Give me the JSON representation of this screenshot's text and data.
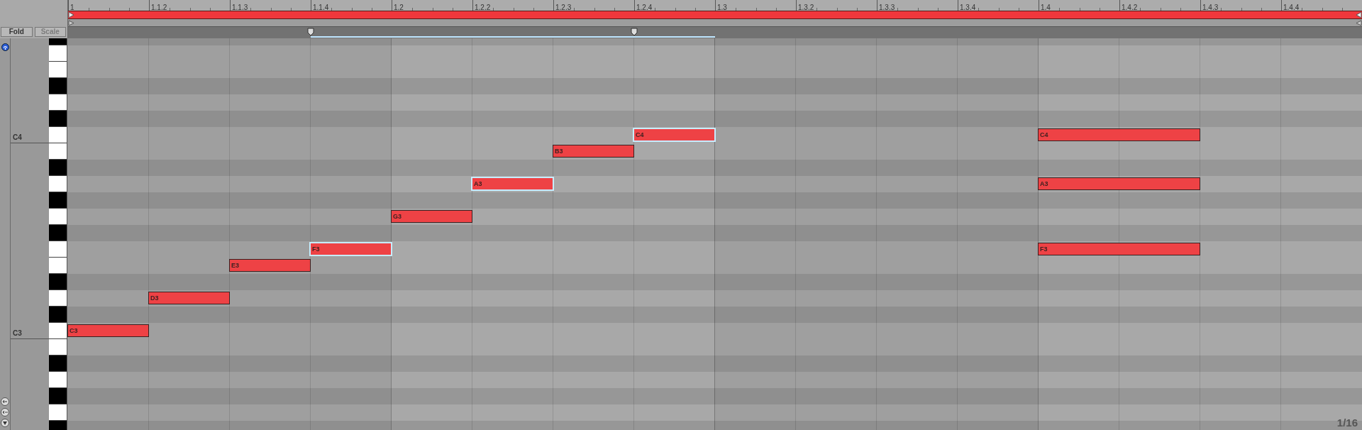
{
  "ruler": {
    "columns": [
      {
        "label": "1",
        "in_region": false,
        "marker": false
      },
      {
        "label": "1.1.2",
        "in_region": false,
        "marker": false
      },
      {
        "label": "1.1.3",
        "in_region": false,
        "marker": false
      },
      {
        "label": "1.1.4",
        "in_region": true,
        "marker": true
      },
      {
        "label": "1.2",
        "in_region": true,
        "marker": false
      },
      {
        "label": "1.2.2",
        "in_region": true,
        "marker": false
      },
      {
        "label": "1.2.3",
        "in_region": true,
        "marker": false
      },
      {
        "label": "1.2.4",
        "in_region": true,
        "marker": true
      },
      {
        "label": "1.3",
        "in_region": false,
        "marker": false
      },
      {
        "label": "1.3.2",
        "in_region": false,
        "marker": false
      },
      {
        "label": "1.3.3",
        "in_region": false,
        "marker": false
      },
      {
        "label": "1.3.4",
        "in_region": false,
        "marker": false
      },
      {
        "label": "1.4",
        "in_region": false,
        "marker": false
      },
      {
        "label": "1.4.2",
        "in_region": false,
        "marker": false
      },
      {
        "label": "1.4.3",
        "in_region": false,
        "marker": false
      },
      {
        "label": "1.4.4",
        "in_region": false,
        "marker": false
      }
    ]
  },
  "buttons": [
    {
      "label": "Fold",
      "disabled": false
    },
    {
      "label": "Scale",
      "disabled": true
    }
  ],
  "rows": [
    {
      "kind": "sharp"
    },
    {
      "kind": "natural"
    },
    {
      "kind": "natural"
    },
    {
      "kind": "sharp"
    },
    {
      "kind": "natural"
    },
    {
      "kind": "sharp"
    },
    {
      "kind": "natural",
      "label": "C4",
      "steps": [
        {
          "kind": "empty"
        },
        {
          "kind": "empty"
        },
        {
          "kind": "empty"
        },
        {
          "kind": "empty"
        },
        {
          "kind": "empty"
        },
        {
          "kind": "empty"
        },
        {
          "kind": "empty"
        },
        {
          "kind": "note",
          "label": "C4",
          "selected": true
        },
        {
          "kind": "empty"
        },
        {
          "kind": "empty"
        },
        {
          "kind": "empty"
        },
        {
          "kind": "empty"
        },
        {
          "kind": "note",
          "label": "C4",
          "selected": false
        },
        {
          "kind": "hold"
        },
        {
          "kind": "empty"
        },
        {
          "kind": "empty"
        }
      ]
    },
    {
      "kind": "natural",
      "steps": [
        {
          "kind": "empty"
        },
        {
          "kind": "empty"
        },
        {
          "kind": "empty"
        },
        {
          "kind": "empty"
        },
        {
          "kind": "empty"
        },
        {
          "kind": "empty"
        },
        {
          "kind": "note",
          "label": "B3",
          "selected": false
        },
        {
          "kind": "empty"
        },
        {
          "kind": "empty"
        },
        {
          "kind": "empty"
        },
        {
          "kind": "empty"
        },
        {
          "kind": "empty"
        },
        {
          "kind": "empty"
        },
        {
          "kind": "empty"
        },
        {
          "kind": "empty"
        },
        {
          "kind": "empty"
        }
      ]
    },
    {
      "kind": "sharp"
    },
    {
      "kind": "natural",
      "steps": [
        {
          "kind": "empty"
        },
        {
          "kind": "empty"
        },
        {
          "kind": "empty"
        },
        {
          "kind": "empty"
        },
        {
          "kind": "empty"
        },
        {
          "kind": "note",
          "label": "A3",
          "selected": true
        },
        {
          "kind": "empty"
        },
        {
          "kind": "empty"
        },
        {
          "kind": "empty"
        },
        {
          "kind": "empty"
        },
        {
          "kind": "empty"
        },
        {
          "kind": "empty"
        },
        {
          "kind": "note",
          "label": "A3",
          "selected": false
        },
        {
          "kind": "hold"
        },
        {
          "kind": "empty"
        },
        {
          "kind": "empty"
        }
      ]
    },
    {
      "kind": "sharp"
    },
    {
      "kind": "natural",
      "steps": [
        {
          "kind": "empty"
        },
        {
          "kind": "empty"
        },
        {
          "kind": "empty"
        },
        {
          "kind": "empty"
        },
        {
          "kind": "note",
          "label": "G3",
          "selected": false
        },
        {
          "kind": "empty"
        },
        {
          "kind": "empty"
        },
        {
          "kind": "empty"
        },
        {
          "kind": "empty"
        },
        {
          "kind": "empty"
        },
        {
          "kind": "empty"
        },
        {
          "kind": "empty"
        },
        {
          "kind": "empty"
        },
        {
          "kind": "empty"
        },
        {
          "kind": "empty"
        },
        {
          "kind": "empty"
        }
      ]
    },
    {
      "kind": "sharp"
    },
    {
      "kind": "natural",
      "steps": [
        {
          "kind": "empty"
        },
        {
          "kind": "empty"
        },
        {
          "kind": "empty"
        },
        {
          "kind": "note",
          "label": "F3",
          "selected": true
        },
        {
          "kind": "empty"
        },
        {
          "kind": "empty"
        },
        {
          "kind": "empty"
        },
        {
          "kind": "empty"
        },
        {
          "kind": "empty"
        },
        {
          "kind": "empty"
        },
        {
          "kind": "empty"
        },
        {
          "kind": "empty"
        },
        {
          "kind": "note",
          "label": "F3",
          "selected": false
        },
        {
          "kind": "hold"
        },
        {
          "kind": "empty"
        },
        {
          "kind": "empty"
        }
      ]
    },
    {
      "kind": "natural",
      "steps": [
        {
          "kind": "empty"
        },
        {
          "kind": "empty"
        },
        {
          "kind": "note",
          "label": "E3",
          "selected": false
        },
        {
          "kind": "empty"
        },
        {
          "kind": "empty"
        },
        {
          "kind": "empty"
        },
        {
          "kind": "empty"
        },
        {
          "kind": "empty"
        },
        {
          "kind": "empty"
        },
        {
          "kind": "empty"
        },
        {
          "kind": "empty"
        },
        {
          "kind": "empty"
        },
        {
          "kind": "empty"
        },
        {
          "kind": "empty"
        },
        {
          "kind": "empty"
        },
        {
          "kind": "empty"
        }
      ]
    },
    {
      "kind": "sharp"
    },
    {
      "kind": "natural",
      "steps": [
        {
          "kind": "empty"
        },
        {
          "kind": "note",
          "label": "D3",
          "selected": false
        },
        {
          "kind": "empty"
        },
        {
          "kind": "empty"
        },
        {
          "kind": "empty"
        },
        {
          "kind": "empty"
        },
        {
          "kind": "empty"
        },
        {
          "kind": "empty"
        },
        {
          "kind": "empty"
        },
        {
          "kind": "empty"
        },
        {
          "kind": "empty"
        },
        {
          "kind": "empty"
        },
        {
          "kind": "empty"
        },
        {
          "kind": "empty"
        },
        {
          "kind": "empty"
        },
        {
          "kind": "empty"
        }
      ]
    },
    {
      "kind": "sharp"
    },
    {
      "kind": "natural",
      "label": "C3",
      "steps": [
        {
          "kind": "note",
          "label": "C3",
          "selected": false
        },
        {
          "kind": "empty"
        },
        {
          "kind": "empty"
        },
        {
          "kind": "empty"
        },
        {
          "kind": "empty"
        },
        {
          "kind": "empty"
        },
        {
          "kind": "empty"
        },
        {
          "kind": "empty"
        },
        {
          "kind": "empty"
        },
        {
          "kind": "empty"
        },
        {
          "kind": "empty"
        },
        {
          "kind": "empty"
        },
        {
          "kind": "empty"
        },
        {
          "kind": "empty"
        },
        {
          "kind": "empty"
        },
        {
          "kind": "empty"
        }
      ]
    },
    {
      "kind": "natural"
    },
    {
      "kind": "sharp"
    },
    {
      "kind": "natural"
    },
    {
      "kind": "sharp"
    },
    {
      "kind": "natural"
    },
    {
      "kind": "sharp"
    }
  ],
  "grid_label": "1/16"
}
